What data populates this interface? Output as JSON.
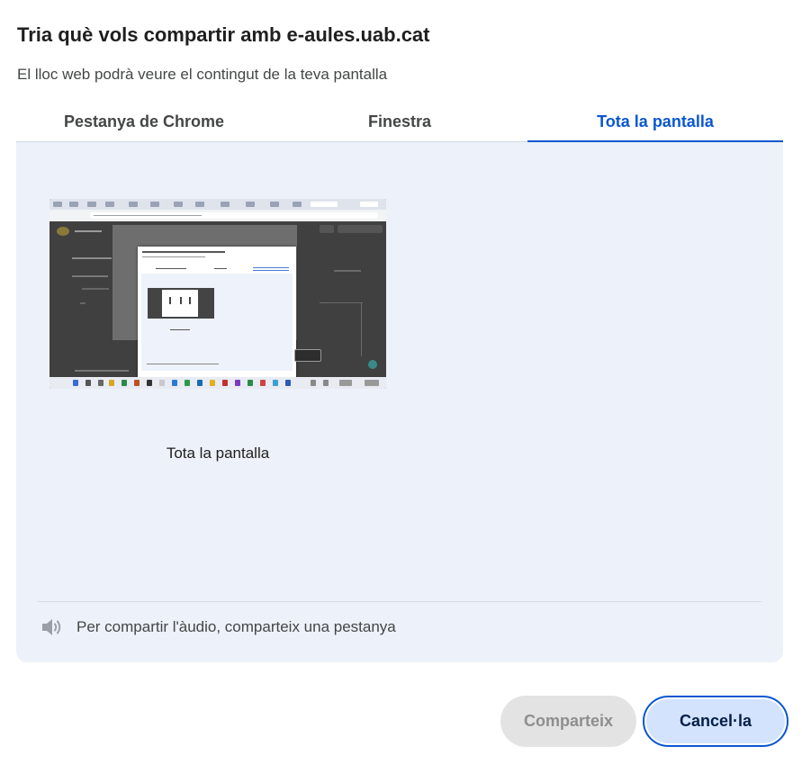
{
  "dialog": {
    "title": "Tria què vols compartir amb e-aules.uab.cat",
    "subtitle": "El lloc web podrà veure el contingut de la teva pantalla"
  },
  "tabs": [
    {
      "label": "Pestanya de Chrome",
      "active": false
    },
    {
      "label": "Finestra",
      "active": false
    },
    {
      "label": "Tota la pantalla",
      "active": true
    }
  ],
  "preview": {
    "label": "Tota la pantalla"
  },
  "audio": {
    "icon": "speaker-icon",
    "text": "Per compartir l'àudio, comparteix una pestanya"
  },
  "buttons": {
    "share_label": "Comparteix",
    "share_enabled": false,
    "cancel_label": "Cancel·la"
  },
  "colors": {
    "accent": "#0b57d0",
    "panel_bg": "#edf1f9",
    "cancel_bg": "#d3e3fd",
    "disabled_bg": "#e3e3e3"
  }
}
